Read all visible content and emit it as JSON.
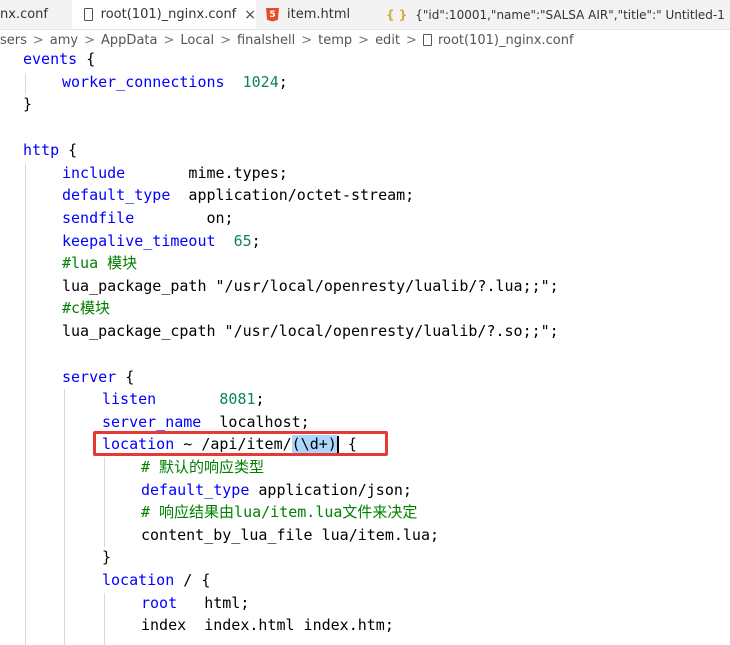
{
  "tabs": [
    {
      "label": "nx.conf"
    },
    {
      "label": "root(101)_nginx.conf",
      "close": "×"
    },
    {
      "label": "item.html",
      "icon_text": "5"
    },
    {
      "label": "{\"id\":10001,\"name\":\"SALSA AIR\",\"title\":\" Untitled-1",
      "icon_text": "{ }"
    }
  ],
  "breadcrumb": [
    "sers",
    "amy",
    "AppData",
    "Local",
    "finalshell",
    "temp",
    "edit",
    "root(101)_nginx.conf"
  ],
  "breadcrumb_sep": ">",
  "code": {
    "l1": {
      "a": "events",
      "b": " {"
    },
    "l2": {
      "a": "worker_connections",
      "b": "  ",
      "c": "1024",
      "d": ";"
    },
    "l3": {
      "a": "}"
    },
    "l5": {
      "a": "http",
      "b": " {"
    },
    "l6": {
      "a": "include",
      "b": "       mime.types;"
    },
    "l7": {
      "a": "default_type",
      "b": "  application/octet-stream;"
    },
    "l8": {
      "a": "sendfile",
      "b": "        on;"
    },
    "l9": {
      "a": "keepalive_timeout",
      "b": "  ",
      "c": "65",
      "d": ";"
    },
    "l10": {
      "a": "#lua 模块"
    },
    "l11": {
      "a": "lua_package_path \"/usr/local/openresty/lualib/?.lua;;\";"
    },
    "l12": {
      "a": "#c模块"
    },
    "l13": {
      "a": "lua_package_cpath \"/usr/local/openresty/lualib/?.so;;\";"
    },
    "l15": {
      "a": "server",
      "b": " {"
    },
    "l16": {
      "a": "listen",
      "b": "       ",
      "c": "8081",
      "d": ";"
    },
    "l17": {
      "a": "server_name",
      "b": "  localhost;"
    },
    "l18": {
      "a": "location",
      "b": " ~ /api/item/",
      "c": "(\\d+)",
      "d": " {"
    },
    "l19": {
      "a": "# 默认的响应类型"
    },
    "l20": {
      "a": "default_type",
      "b": " application/json;"
    },
    "l21": {
      "a": "# 响应结果由lua/item.lua文件来决定"
    },
    "l22": {
      "a": "content_by_lua_file lua/item.lua;"
    },
    "l23": {
      "a": "}"
    },
    "l24": {
      "a": "location",
      "b": " / {"
    },
    "l25": {
      "a": "root",
      "b": "   html;"
    },
    "l26": {
      "a": "index",
      "b": "  index.html index.htm;"
    }
  }
}
